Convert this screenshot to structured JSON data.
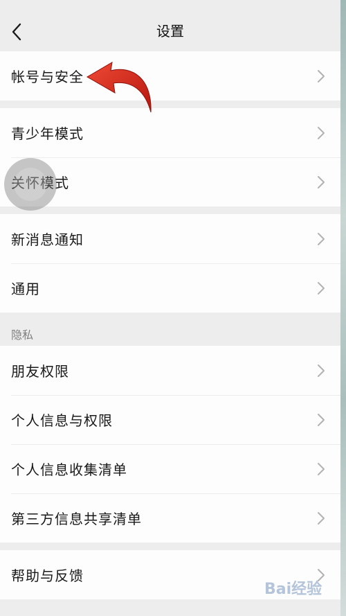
{
  "header": {
    "title": "设置",
    "back_icon": "chevron-left-icon"
  },
  "groups": [
    {
      "items": [
        {
          "label": "帐号与安全"
        }
      ]
    },
    {
      "items": [
        {
          "label": "青少年模式"
        },
        {
          "label": "关怀模式"
        }
      ]
    },
    {
      "items": [
        {
          "label": "新消息通知"
        },
        {
          "label": "通用"
        }
      ]
    },
    {
      "section_title": "隐私",
      "items": [
        {
          "label": "朋友权限"
        },
        {
          "label": "个人信息与权限"
        },
        {
          "label": "个人信息收集清单"
        },
        {
          "label": "第三方信息共享清单"
        }
      ]
    },
    {
      "items": [
        {
          "label": "帮助与反馈"
        }
      ]
    }
  ],
  "watermark": {
    "text": "Bai经验"
  },
  "colors": {
    "background": "#ededed",
    "row_bg": "#fdfdfd",
    "arrow": "#d7261b",
    "chevron": "#b2b2b2"
  }
}
